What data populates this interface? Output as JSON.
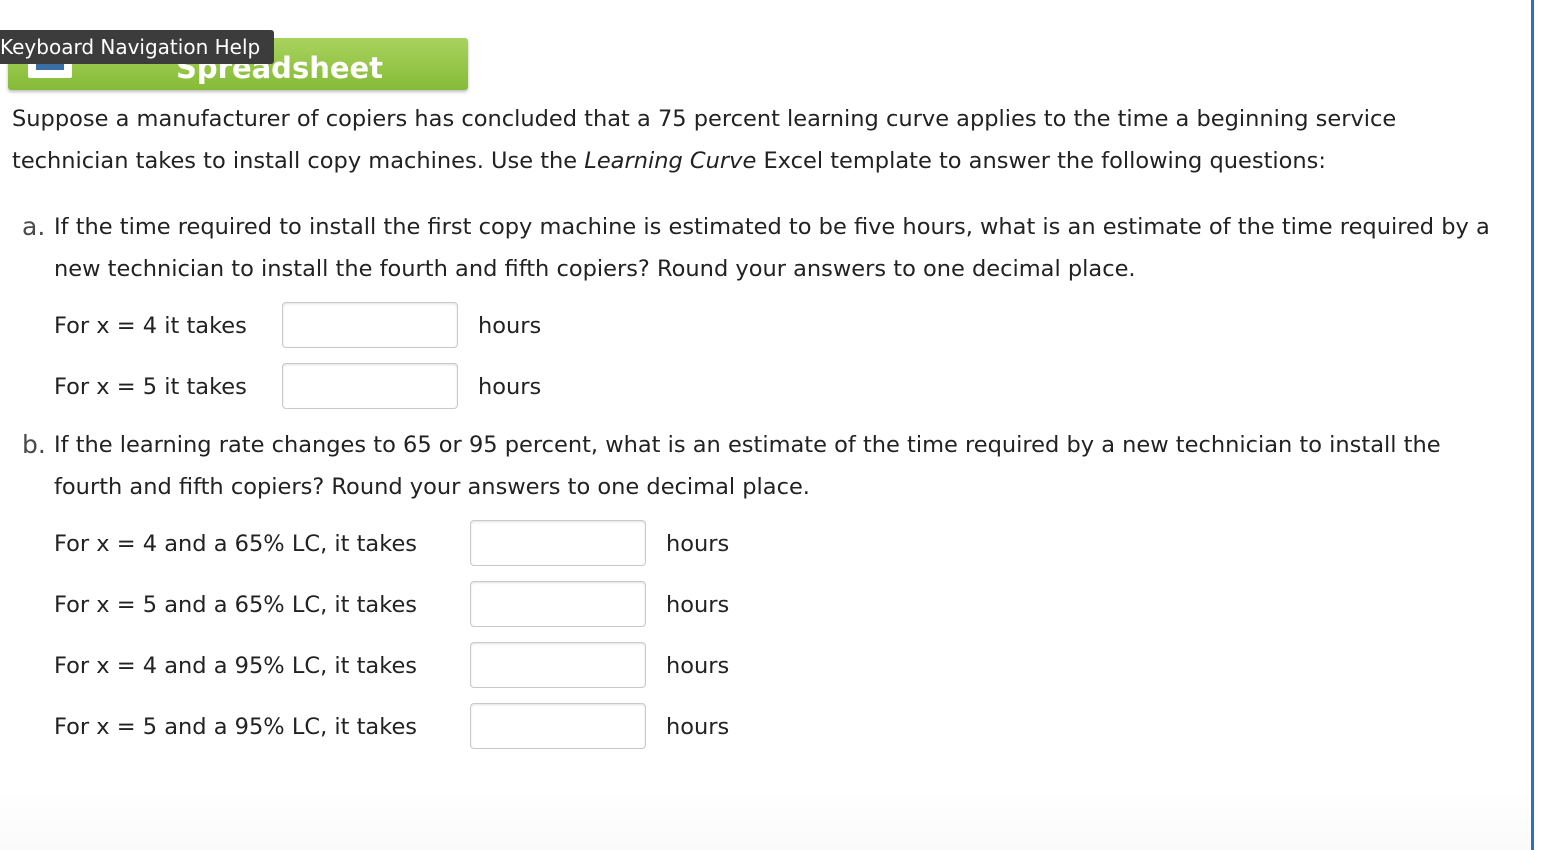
{
  "header": {
    "keyboard_help": "Keyboard Navigation Help",
    "spreadsheet_label": "Spreadsheet"
  },
  "intro": {
    "before": "Suppose a manufacturer of copiers has concluded that a 75 percent learning curve applies to the time a beginning service technician takes to install copy machines. Use the ",
    "emphasis": "Learning Curve",
    "after": " Excel template to answer the following questions:"
  },
  "part_a": {
    "marker": "a.",
    "question": "If the time required to install the first copy machine is estimated to be five hours, what is an estimate of the time required by a new technician to install the fourth and fifth copiers? Round your answers to one decimal place.",
    "rows": [
      {
        "label": "For x = 4 it takes",
        "value": "",
        "unit": "hours"
      },
      {
        "label": "For x = 5 it takes",
        "value": "",
        "unit": "hours"
      }
    ]
  },
  "part_b": {
    "marker": "b.",
    "question": "If the learning rate changes to 65 or 95 percent, what is an estimate of the time required by a new technician to install the fourth and fifth copiers? Round your answers to one decimal place.",
    "rows": [
      {
        "label": "For x = 4 and a 65% LC, it takes",
        "value": "",
        "unit": "hours"
      },
      {
        "label": "For x = 5 and a 65% LC, it takes",
        "value": "",
        "unit": "hours"
      },
      {
        "label": "For x = 4 and a 95% LC, it takes",
        "value": "",
        "unit": "hours"
      },
      {
        "label": "For x = 5 and a 95% LC, it takes",
        "value": "",
        "unit": "hours"
      }
    ]
  },
  "colors": {
    "spreadsheet_green": "#8cc63f",
    "tooltip_bg": "#3c3c3c",
    "frame_blue": "#2e6fc0"
  }
}
